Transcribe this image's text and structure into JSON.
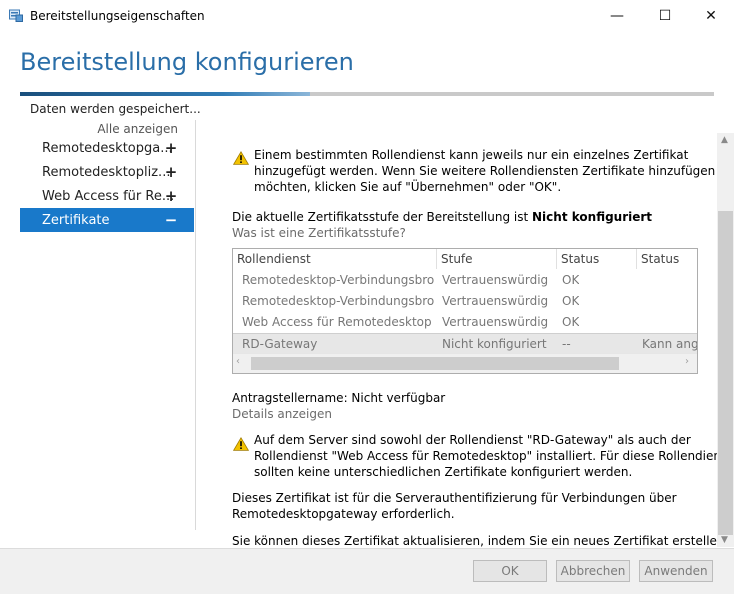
{
  "window": {
    "title": "Bereitstellungseigenschaften",
    "minimize": "—",
    "maximize": "☐",
    "close": "✕"
  },
  "header": {
    "title": "Bereitstellung konfigurieren"
  },
  "nav": {
    "heading": "Daten werden gespeichert...",
    "show_all": "Alle anzeigen",
    "items": [
      {
        "label": "Remotedesktopga...",
        "sign": "+"
      },
      {
        "label": "Remotedesktopliz...",
        "sign": "+"
      },
      {
        "label": "Web Access für Re...",
        "sign": "+"
      },
      {
        "label": "Zertifikate",
        "sign": "−"
      }
    ]
  },
  "content": {
    "warning1": {
      "line1": "Einem bestimmten Rollendienst kann jeweils nur ein einzelnes Zertifikat",
      "line2": "hinzugefügt werden. Wenn Sie weitere Rollendiensten Zertifikate hinzufügen",
      "line3": "möchten, klicken Sie auf \"Übernehmen\" oder \"OK\"."
    },
    "cert_level_prefix": "Die aktuelle Zertifikatsstufe der Bereitstellung ist ",
    "cert_level_value": "Nicht konfiguriert",
    "cert_level_link": "Was ist eine Zertifikatsstufe?",
    "table": {
      "columns": [
        "Rollendienst",
        "Stufe",
        "Status",
        "Status"
      ],
      "rows": [
        [
          "Remotedesktop-Verbindungsbroker",
          "Vertrauenswürdig",
          "OK",
          ""
        ],
        [
          "Remotedesktop-Verbindungsbroker",
          "Vertrauenswürdig",
          "OK",
          ""
        ],
        [
          "Web Access für Remotedesktop",
          "Vertrauenswürdig",
          "OK",
          ""
        ],
        [
          "RD-Gateway",
          "Nicht konfiguriert",
          "--",
          "Kann angeben"
        ]
      ]
    },
    "requester_label": "Antragstellername: Nicht verfügbar",
    "details_link": "Details anzeigen",
    "warning2": {
      "line1": "Auf dem Server sind sowohl der Rollendienst \"RD-Gateway\" als auch der",
      "line2": "Rollendienst \"Web Access für Remotedesktop\" installiert. Für diese Rollendienste",
      "line3": "sollten keine unterschiedlichen Zertifikate konfiguriert werden."
    },
    "info": {
      "line1": "Dieses Zertifikat ist für die Serverauthentifizierung für Verbindungen über",
      "line2": "Remotedesktopgateway erforderlich."
    },
    "update_text": "Sie können dieses Zertifikat aktualisieren, indem Sie ein neues Zertifikat erstellen oder"
  },
  "footer": {
    "ok": "OK",
    "cancel": "Abbrechen",
    "apply": "Anwenden"
  },
  "colors": {
    "accent": "#1979ca",
    "heading": "#2a6ea8",
    "warning": "#f2c200"
  }
}
